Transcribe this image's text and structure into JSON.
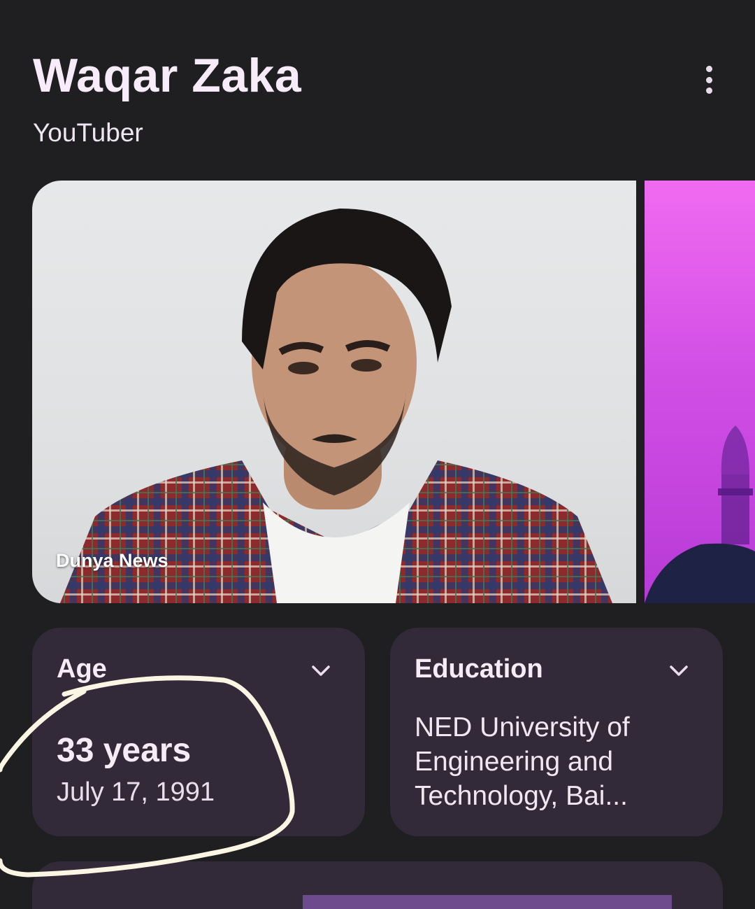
{
  "header": {
    "title": "Waqar Zaka",
    "subtitle": "YouTuber"
  },
  "icons": {
    "more": "more-vert-icon",
    "expand": "chevron-down-icon"
  },
  "images": {
    "main_caption": "Dunya News"
  },
  "facts": {
    "age": {
      "label": "Age",
      "value": "33 years",
      "date": "July 17, 1991"
    },
    "education": {
      "label": "Education",
      "value": "NED University of Engineering and Technology, Bai..."
    }
  },
  "colors": {
    "background": "#1f1f21",
    "card": "#322a38",
    "highlight": "#6d4b8c",
    "annotation": "#fbf6e4"
  }
}
